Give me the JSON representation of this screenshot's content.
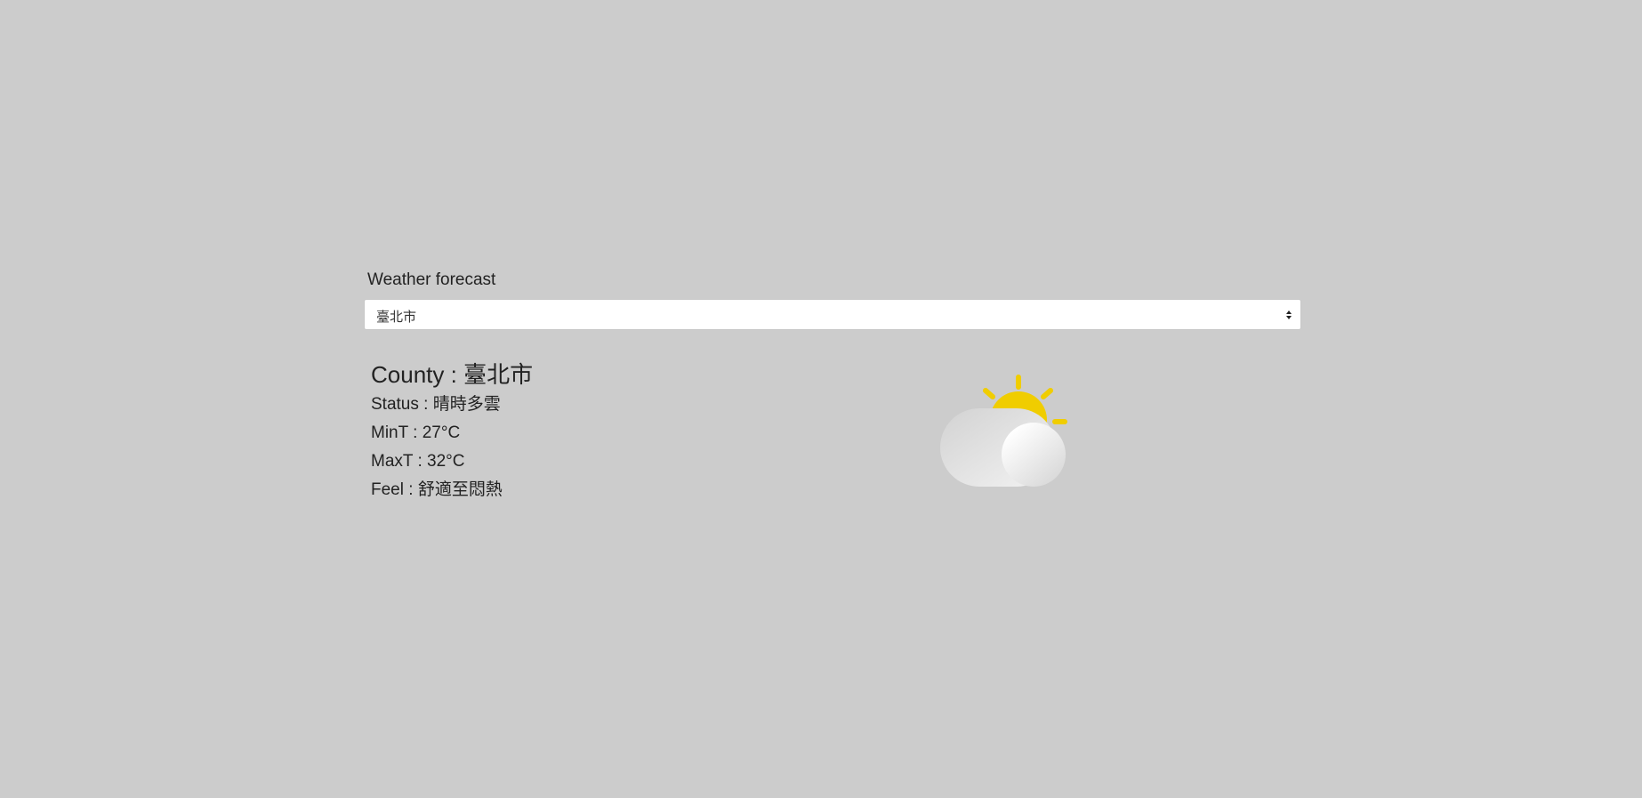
{
  "header": {
    "title": "Weather forecast"
  },
  "county_select": {
    "selected": "臺北市"
  },
  "forecast": {
    "county_label": "County",
    "county": "臺北市",
    "status_label": "Status",
    "status": "晴時多雲",
    "min_label": "MinT",
    "min_temp": "27°C",
    "max_label": "MaxT",
    "max_temp": "32°C",
    "feel_label": "Feel",
    "feel": "舒適至悶熱"
  },
  "icon": {
    "name": "partly-cloudy-icon",
    "sun_color": "#f0cd00",
    "cloud_color": "#e6e6e6"
  },
  "colors": {
    "background": "#cccccc",
    "text": "#222222"
  }
}
